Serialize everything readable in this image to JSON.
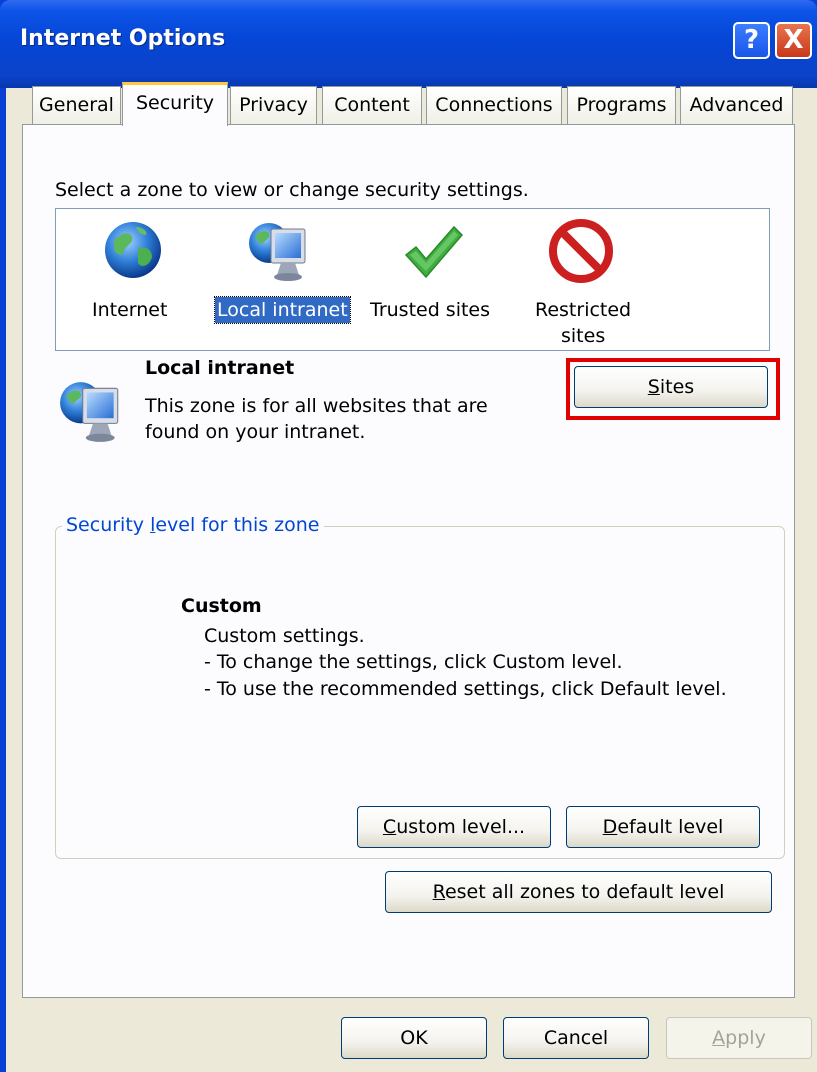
{
  "window": {
    "title": "Internet Options",
    "help_label": "?",
    "close_label": "X"
  },
  "tabs": [
    {
      "label": "General",
      "active": false
    },
    {
      "label": "Security",
      "active": true
    },
    {
      "label": "Privacy",
      "active": false
    },
    {
      "label": "Content",
      "active": false
    },
    {
      "label": "Connections",
      "active": false
    },
    {
      "label": "Programs",
      "active": false
    },
    {
      "label": "Advanced",
      "active": false
    }
  ],
  "security": {
    "instruction": "Select a zone to view or change security settings.",
    "zones": [
      {
        "label": "Internet",
        "icon": "globe-icon",
        "selected": false
      },
      {
        "label": "Local intranet",
        "icon": "intranet-icon",
        "selected": true
      },
      {
        "label": "Trusted sites",
        "icon": "checkmark-icon",
        "selected": false
      },
      {
        "label_line1": "Restricted",
        "label_line2": "sites",
        "icon": "no-entry-icon",
        "selected": false
      }
    ],
    "selected_zone": {
      "name": "Local intranet",
      "description_line1": "This zone is for all websites that are",
      "description_line2": "found on your intranet.",
      "icon": "intranet-icon"
    },
    "sites_button": {
      "mnemonic": "S",
      "rest": "ites"
    },
    "level_group": {
      "title_pre": "Security ",
      "title_mnemonic": "l",
      "title_post": "evel for this zone",
      "level_name": "Custom",
      "line1": "Custom settings.",
      "line2": "- To change the settings, click Custom level.",
      "line3": "- To use the recommended settings, click Default level."
    },
    "custom_level_button": {
      "mnemonic": "C",
      "rest": "ustom level..."
    },
    "default_level_button": {
      "mnemonic": "D",
      "rest": "efault level"
    },
    "reset_button": {
      "mnemonic": "R",
      "rest": "eset all zones to default level"
    }
  },
  "footer": {
    "ok_label": "OK",
    "cancel_label": "Cancel",
    "apply": {
      "mnemonic": "A",
      "rest": "pply",
      "enabled": false
    }
  },
  "colors": {
    "title_bar": "#0546d6",
    "dialog_bg": "#ece9d8",
    "selection": "#316ac5",
    "group_title": "#0046d5",
    "highlight_box": "#e00000"
  }
}
